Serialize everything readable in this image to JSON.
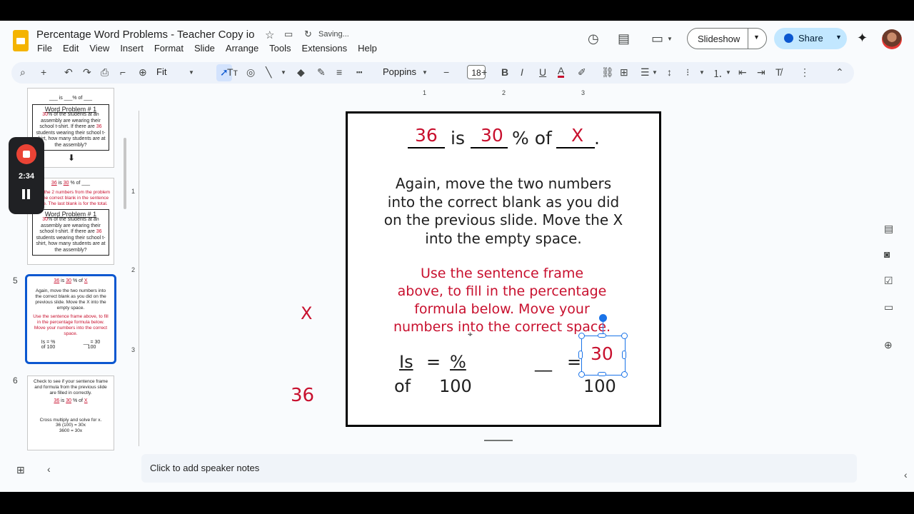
{
  "app": {
    "doc_title": "Percentage Word Problems - Teacher Copy io",
    "saving": "Saving...",
    "menu": [
      "File",
      "Edit",
      "View",
      "Insert",
      "Format",
      "Slide",
      "Arrange",
      "Tools",
      "Extensions",
      "Help"
    ],
    "slideshow_label": "Slideshow",
    "share_label": "Share"
  },
  "toolbar": {
    "zoom": "Fit",
    "font": "Poppins",
    "font_size": "18"
  },
  "ruler": {
    "h": [
      "1",
      "2",
      "3"
    ],
    "v": [
      "1",
      "2",
      "3"
    ]
  },
  "recorder": {
    "time": "2:34"
  },
  "thumbnails": {
    "t3": {
      "sentence": "___ is ___% of ___",
      "box_title": "Word Problem # 1",
      "box_text_a": "30",
      "box_text_b": "% of the students at an assembly are wearing their school t-shirt. If there are ",
      "box_text_c": "36",
      "box_text_d": " students wearing their school t-shirt, how many students are at the assembly?"
    },
    "t4": {
      "n1": "36",
      "is": "is",
      "n2": "30",
      "of": "% of ___",
      "instruction": "Move the 2 numbers from the problem into the correct blank in the sentence frame. The last blank is for the total.",
      "box_title": "Word Problem # 1",
      "box_text_a": "30",
      "box_text_b": "% of the students at an assembly are wearing their school t-shirt. If there are ",
      "box_text_c": "36",
      "box_text_d": " students wearing their school t-shirt, how many students are at the assembly?"
    },
    "t5": {
      "number": "5",
      "n1": "36",
      "is": "is",
      "n2": "30",
      "of": "% of",
      "x": "X",
      "black": "Again, move the two numbers into the correct blank as you did on the previous slide. Move the X into the empty space.",
      "red": "Use the sentence frame above, to fill in the percentage formula below. Move your numbers into the correct space.",
      "f1": "Is = %",
      "f2": "of    100",
      "f3": "__ = 30",
      "f4": "100"
    },
    "t6": {
      "number": "6",
      "text": "Check to see if your sentence frame and formula from the previous slide are filled in correctly.",
      "n1": "36",
      "is": "is",
      "n2": "30",
      "of": "% of",
      "x": "X",
      "cross": "Cross multiply and solve for x.",
      "eq1": "36 (100) = 30x",
      "eq2": "3600 = 30x"
    }
  },
  "slide": {
    "blank1_value": "36",
    "is_word": "is",
    "blank2_value": "30",
    "pct_of": "% of",
    "blank3_value": "X",
    "period": ".",
    "black_text_lines": [
      "Again, move the two numbers",
      "into the correct blank as you did",
      "on the previous slide.  Move the X",
      "into the empty space."
    ],
    "red_text_lines": [
      "Use the sentence frame",
      "above, to fill in the percentage",
      "formula below.  Move your",
      "numbers into the correct space."
    ],
    "formula_is": "Is",
    "formula_eq": "=",
    "formula_pct": "%",
    "formula_of": "of",
    "formula_100": "100",
    "formula2_blank": "__",
    "formula2_eq": "=",
    "formula2_selected": "30",
    "formula2_100": "100"
  },
  "offslide": {
    "x": "X",
    "n36": "36"
  },
  "notes": {
    "placeholder": "Click to add speaker notes"
  },
  "colors": {
    "red": "#c8102e",
    "accent": "#0b57d0",
    "share_bg": "#c2e7ff"
  }
}
